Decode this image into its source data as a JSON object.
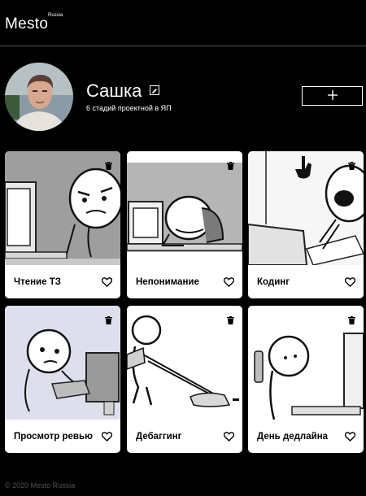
{
  "header": {
    "logo": "Mesto",
    "logo_sub": "Russia"
  },
  "profile": {
    "name": "Сашка",
    "about": "6 стадий проектной в ЯП"
  },
  "cards": [
    {
      "title": "Чтение ТЗ"
    },
    {
      "title": "Непонимание"
    },
    {
      "title": "Кодинг"
    },
    {
      "title": "Просмотр ревью"
    },
    {
      "title": "Дебаггинг"
    },
    {
      "title": "День дедлайна"
    }
  ],
  "footer": {
    "copyright": "© 2020 Mesto Russia"
  },
  "icons": {
    "edit": "pencil-icon",
    "add": "plus-icon",
    "delete": "trash-icon",
    "like": "heart-icon"
  },
  "colors": {
    "background": "#000000",
    "card": "#ffffff",
    "footer_text": "#545454"
  }
}
